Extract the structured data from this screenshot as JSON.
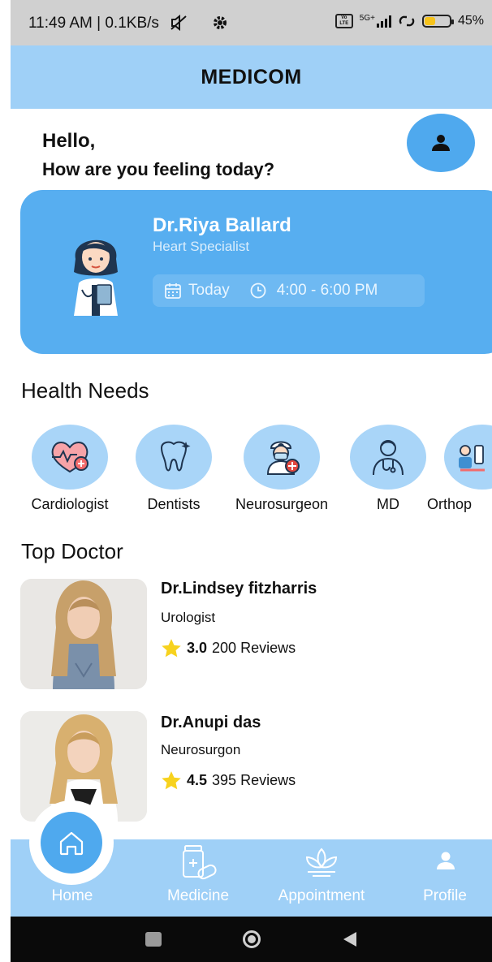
{
  "status_bar": {
    "time": "11:49 AM | 0.1KB/s",
    "volte": "Vo LTE",
    "network": "5G+",
    "battery_percent": "45%",
    "battery_level": 0.45
  },
  "app": {
    "title": "MEDICOM"
  },
  "greeting": {
    "hello": "Hello,",
    "question": "How are you feeling today?"
  },
  "featured_doctor": {
    "name": "Dr.Riya Ballard",
    "specialty": "Heart Specialist",
    "day": "Today",
    "time": "4:00 - 6:00 PM"
  },
  "health_needs": {
    "title": "Health Needs",
    "items": [
      {
        "label": "Cardiologist",
        "icon": "heart-pulse-icon"
      },
      {
        "label": "Dentists",
        "icon": "tooth-icon"
      },
      {
        "label": "Neurosurgeon",
        "icon": "surgeon-icon"
      },
      {
        "label": "MD",
        "icon": "doctor-icon"
      },
      {
        "label": "Orthop",
        "icon": "orthopedic-icon"
      }
    ]
  },
  "top_doctor": {
    "title": "Top Doctor",
    "doctors": [
      {
        "name": "Dr.Lindsey fitzharris",
        "specialty": "Urologist",
        "rating": "3.0",
        "reviews": "200 Reviews"
      },
      {
        "name": "Dr.Anupi das",
        "specialty": "Neurosurgon",
        "rating": "4.5",
        "reviews": "395 Reviews"
      }
    ]
  },
  "bottom_nav": {
    "items": [
      {
        "label": "Home",
        "icon": "home-icon"
      },
      {
        "label": "Medicine",
        "icon": "medicine-icon"
      },
      {
        "label": "Appointment",
        "icon": "lotus-icon"
      },
      {
        "label": "Profile",
        "icon": "person-icon"
      }
    ]
  },
  "colors": {
    "accent": "#57aef0",
    "light_accent": "#9fd0f7",
    "star": "#f7d21e"
  }
}
